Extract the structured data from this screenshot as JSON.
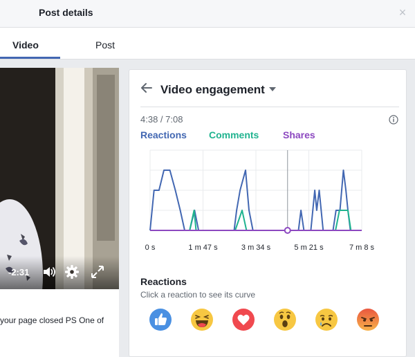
{
  "header": {
    "title": "Post details",
    "close_glyph": "×"
  },
  "tabs": [
    {
      "label": "Video",
      "active": true
    },
    {
      "label": "Post",
      "active": false
    }
  ],
  "video": {
    "time_remaining": "-2:31",
    "caption": "your page closed PS One of",
    "icons": [
      "volume-icon",
      "gear-icon",
      "expand-icon"
    ]
  },
  "engagement": {
    "title": "Video engagement",
    "time_readout": "4:38 / 7:08",
    "legend": [
      {
        "label": "Reactions",
        "color": "#4267b2"
      },
      {
        "label": "Comments",
        "color": "#20b38f"
      },
      {
        "label": "Shares",
        "color": "#8c48c0"
      }
    ]
  },
  "chart_data": {
    "type": "line",
    "x_unit": "seconds",
    "xlim": [
      0,
      428
    ],
    "ylim": [
      0,
      4
    ],
    "x_ticks": [
      {
        "value": 0,
        "label": "0 s"
      },
      {
        "value": 107,
        "label": "1 m 47 s"
      },
      {
        "value": 214,
        "label": "3 m 34 s"
      },
      {
        "value": 321,
        "label": "5 m 21 s"
      },
      {
        "value": 428,
        "label": "7 m 8 s"
      }
    ],
    "current_time": 278,
    "series": [
      {
        "name": "Reactions",
        "color": "#4267b2",
        "points": [
          [
            0,
            0
          ],
          [
            8,
            2
          ],
          [
            18,
            2
          ],
          [
            28,
            3
          ],
          [
            40,
            3
          ],
          [
            51,
            2
          ],
          [
            61,
            1
          ],
          [
            70,
            0
          ],
          [
            80,
            0
          ],
          [
            90,
            1
          ],
          [
            98,
            0
          ],
          [
            170,
            0
          ],
          [
            175,
            1
          ],
          [
            182,
            2
          ],
          [
            193,
            3
          ],
          [
            200,
            1
          ],
          [
            208,
            0
          ],
          [
            300,
            0
          ],
          [
            305,
            1
          ],
          [
            311,
            0
          ],
          [
            325,
            0
          ],
          [
            333,
            2
          ],
          [
            337,
            1
          ],
          [
            342,
            2
          ],
          [
            350,
            0
          ],
          [
            370,
            0
          ],
          [
            376,
            1
          ],
          [
            384,
            1
          ],
          [
            391,
            3
          ],
          [
            396,
            2
          ],
          [
            400,
            1
          ],
          [
            405,
            0
          ],
          [
            428,
            0
          ]
        ]
      },
      {
        "name": "Comments",
        "color": "#20b38f",
        "points": [
          [
            0,
            0
          ],
          [
            80,
            0
          ],
          [
            89,
            1
          ],
          [
            93,
            0
          ],
          [
            172,
            0
          ],
          [
            186,
            1
          ],
          [
            195,
            0
          ],
          [
            375,
            0
          ],
          [
            383,
            1
          ],
          [
            391,
            1
          ],
          [
            400,
            1
          ],
          [
            406,
            0
          ],
          [
            428,
            0
          ]
        ]
      },
      {
        "name": "Shares",
        "color": "#8c48c0",
        "points": [
          [
            0,
            0
          ],
          [
            428,
            0
          ]
        ]
      }
    ]
  },
  "reactions": {
    "heading": "Reactions",
    "subtitle": "Click a reaction to see its curve",
    "items": [
      {
        "name": "like",
        "color": "#4a90e2"
      },
      {
        "name": "haha",
        "color": "#f7c742"
      },
      {
        "name": "love",
        "color": "#f0494f"
      },
      {
        "name": "wow",
        "color": "#f7c742"
      },
      {
        "name": "sad",
        "color": "#f7c742"
      },
      {
        "name": "angry",
        "color": "#f0743a"
      }
    ]
  }
}
